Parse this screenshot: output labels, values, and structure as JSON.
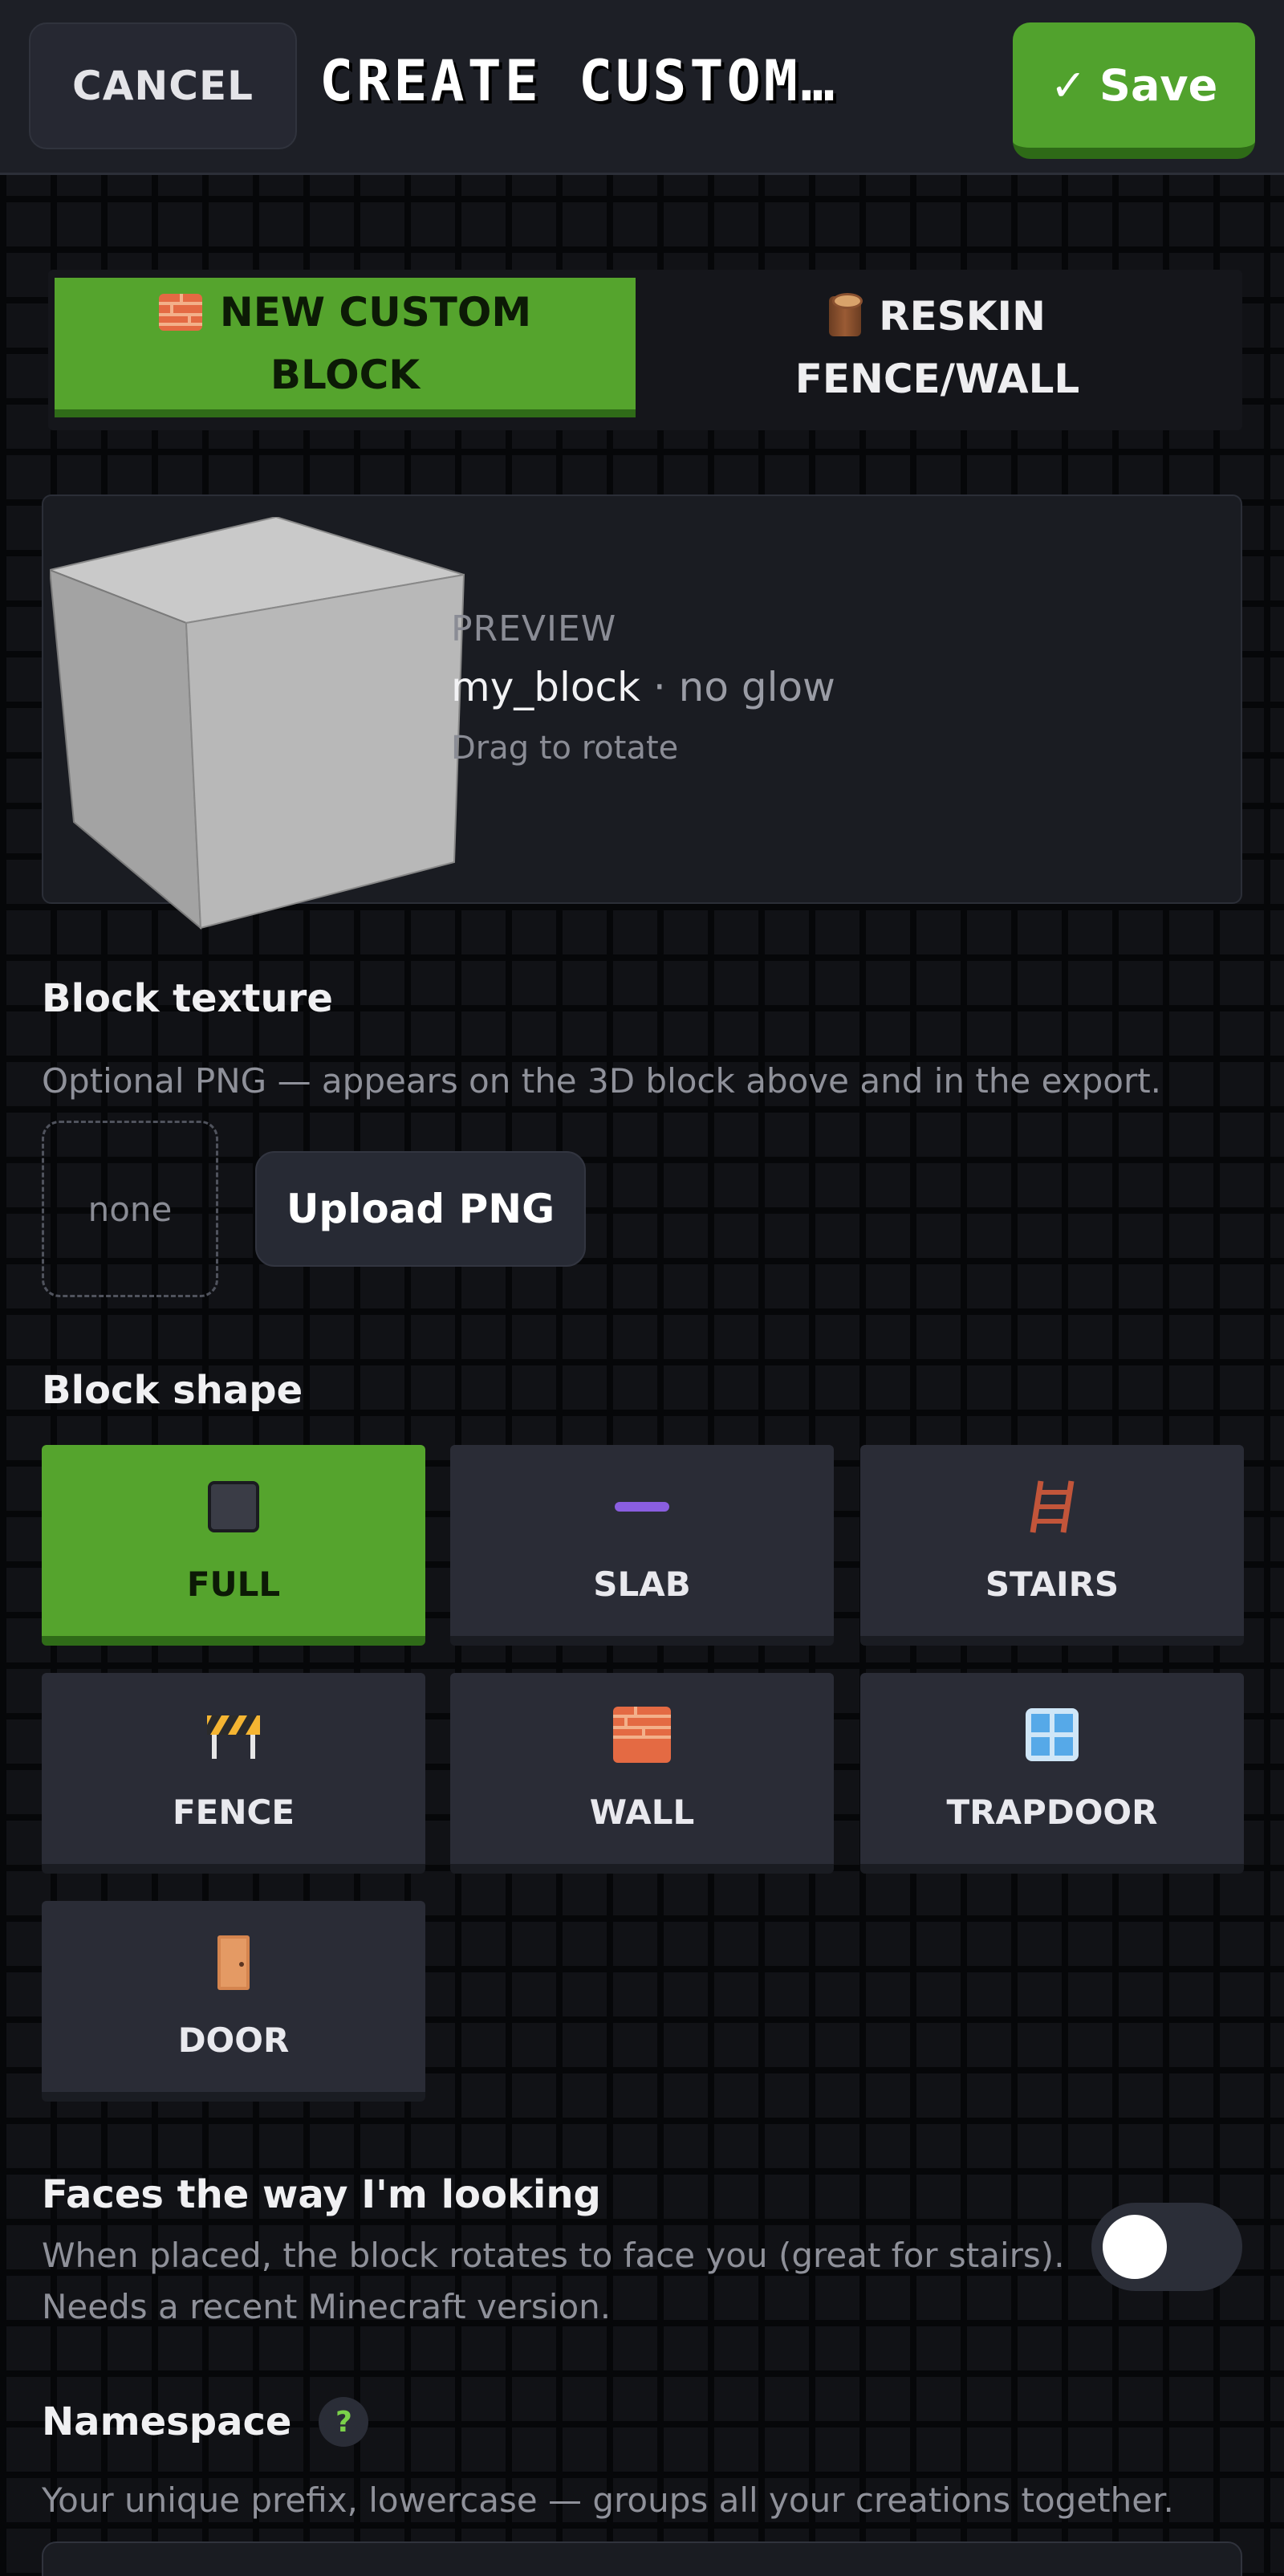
{
  "header": {
    "cancel_label": "CANCEL",
    "title": "CREATE CUSTOM…",
    "save_label": "Save",
    "save_icon": "✓"
  },
  "mode_tabs": [
    {
      "line1": "NEW CUSTOM",
      "line2": "BLOCK",
      "icon": "brick-icon",
      "active": true
    },
    {
      "line1": "RESKIN",
      "line2": "FENCE/WALL",
      "icon": "log-icon",
      "active": false
    }
  ],
  "preview": {
    "label": "PREVIEW",
    "block_name": "my_block",
    "glow_text": "· no glow",
    "hint": "Drag to rotate"
  },
  "texture": {
    "title": "Block texture",
    "description": "Optional PNG — appears on the 3D block above and in the export.",
    "slot_text": "none",
    "upload_label": "Upload PNG"
  },
  "shape": {
    "title": "Block shape",
    "options": [
      {
        "label": "FULL",
        "icon": "full-block-icon",
        "selected": true
      },
      {
        "label": "SLAB",
        "icon": "slab-icon",
        "selected": false
      },
      {
        "label": "STAIRS",
        "icon": "ladder-icon",
        "selected": false
      },
      {
        "label": "FENCE",
        "icon": "barrier-icon",
        "selected": false
      },
      {
        "label": "WALL",
        "icon": "brick-icon",
        "selected": false
      },
      {
        "label": "TRAPDOOR",
        "icon": "window-icon",
        "selected": false
      },
      {
        "label": "DOOR",
        "icon": "door-icon",
        "selected": false
      }
    ]
  },
  "facing": {
    "title": "Faces the way I'm looking",
    "description_line1": "When placed, the block rotates to face you (great for stairs).",
    "description_line2": "Needs a recent Minecraft version.",
    "enabled": false
  },
  "namespace": {
    "title": "Namespace",
    "help_icon": "?",
    "description": "Your unique prefix, lowercase — groups all your creations together."
  },
  "colors": {
    "accent_green": "#55a42d",
    "background": "#111216",
    "card": "#2a2c36"
  }
}
